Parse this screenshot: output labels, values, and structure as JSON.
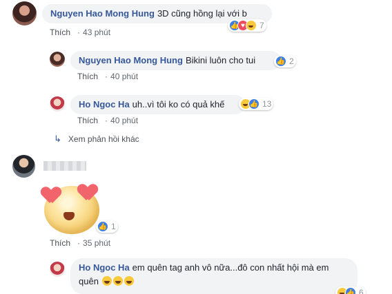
{
  "comments": [
    {
      "author": "Nguyen Hao Mong Hung",
      "text": "3D cũng hồng lại với b",
      "like_label": "Thích",
      "time": "43 phút",
      "reaction_count": "7",
      "reactions": [
        "like-icon",
        "love-icon",
        "haha-icon"
      ]
    },
    {
      "author": "Nguyen Hao Mong Hung",
      "text": "Bikini luôn cho tui",
      "like_label": "Thích",
      "time": "40 phút",
      "reaction_count": "2",
      "reactions": [
        "like-icon"
      ]
    },
    {
      "author": "Ho Ngoc Ha",
      "text": "uh..vì tôi ko có quả khế",
      "like_label": "Thích",
      "time": "40 phút",
      "reaction_count": "13",
      "reactions": [
        "haha-icon",
        "like-icon"
      ]
    },
    {
      "author": "",
      "text": "",
      "sticker": "heart-eyes-sticker",
      "like_label": "Thích",
      "time": "35 phút",
      "reaction_count": "1",
      "reactions": [
        "like-icon"
      ]
    },
    {
      "author": "Ho Ngoc Ha",
      "text": "em quên tag anh vô nữa...đô con nhất hội mà em quên",
      "emoji_suffix": [
        "haha-emoji",
        "haha-emoji",
        "haha-emoji"
      ],
      "reaction_count": "6",
      "reactions": [
        "haha-icon",
        "like-icon"
      ]
    }
  ],
  "more_replies": {
    "icon": "reply-arrow-icon",
    "label": "Xem phản hồi khác"
  },
  "colors": {
    "name": "#365899",
    "bubble": "#f2f3f5",
    "meta": "#616770",
    "like_reaction": "#3b7fe6",
    "love_reaction": "#ed4b5e",
    "haha_reaction": "#f7c93b"
  }
}
